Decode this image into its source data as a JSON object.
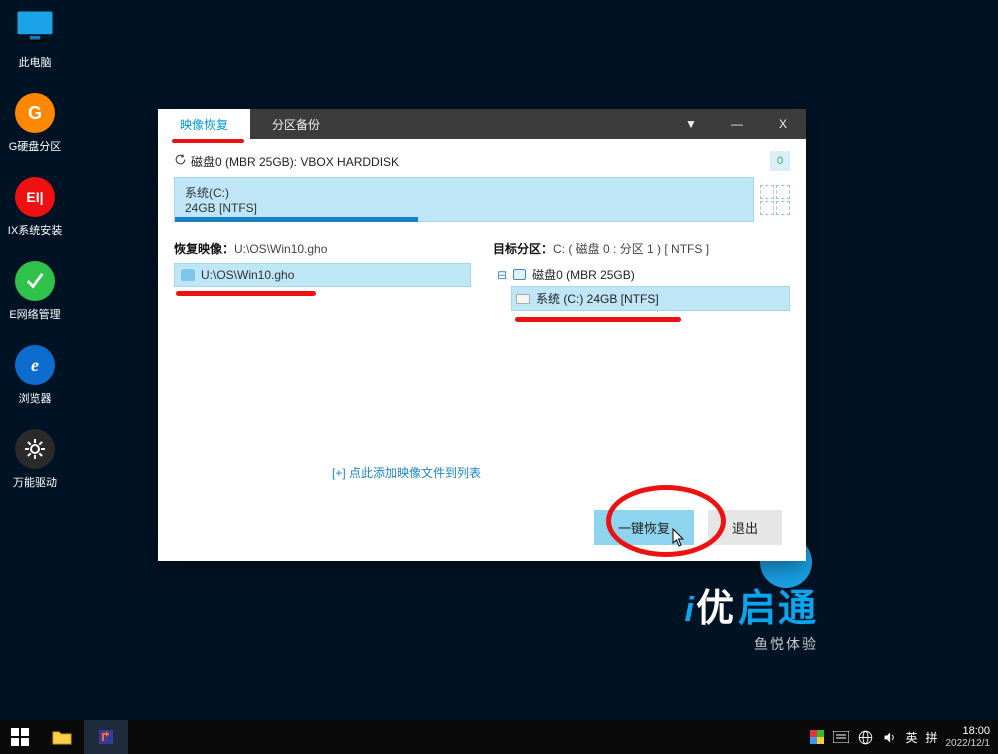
{
  "desktop": {
    "items": [
      {
        "label": "此电脑"
      },
      {
        "label": "G硬盘分区"
      },
      {
        "label": "IX系统安装"
      },
      {
        "label": "E网络管理"
      },
      {
        "label": "浏览器"
      },
      {
        "label": "万能驱动"
      }
    ]
  },
  "dialog": {
    "tabs": {
      "restore": "映像恢复",
      "backup": "分区备份"
    },
    "disk": {
      "title": "磁盘0 (MBR 25GB): VBOX HARDDISK",
      "badge": "0",
      "partition_name": "系统(C:)",
      "partition_size": "24GB [NTFS]"
    },
    "left": {
      "title_prefix": "恢复映像：",
      "title_value": "U:\\OS\\Win10.gho",
      "item": "U:\\OS\\Win10.gho"
    },
    "right": {
      "title_prefix": "目标分区：",
      "title_value": "C: ( 磁盘 0 : 分区 1 ) [ NTFS ]",
      "disk_node": "磁盘0 (MBR 25GB)",
      "part_node": "系统 (C:) 24GB [NTFS]"
    },
    "add_link": "[+] 点此添加映像文件到列表",
    "actions": {
      "restore": "一键恢复",
      "exit": "退出"
    }
  },
  "brand": {
    "i": "i",
    "you": "优",
    "qitong": "启通",
    "sub": "鱼悦体验"
  },
  "tray": {
    "ime1": "英",
    "ime2": "拼",
    "time": "18:00",
    "date": "2022/12/1"
  }
}
